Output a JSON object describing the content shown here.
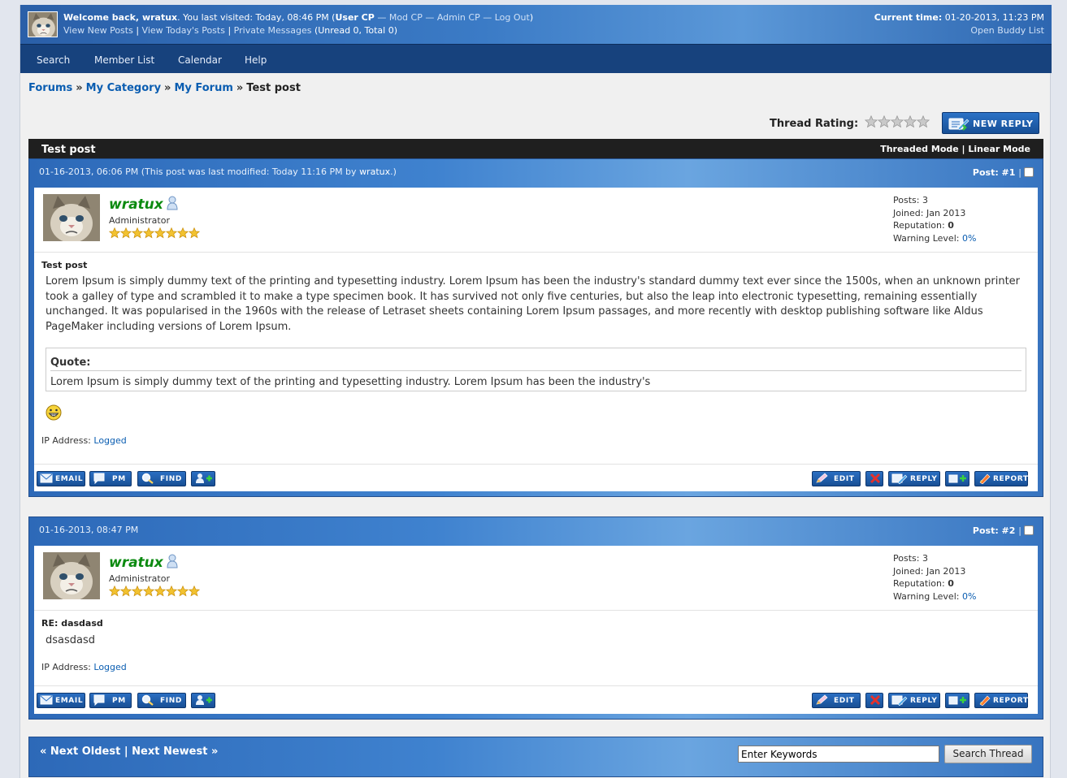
{
  "panel": {
    "welcome_prefix": "Welcome back, ",
    "username": "wratux",
    "last_visit": ". You last visited: Today, 08:46 PM (",
    "user_cp": "User CP",
    "sep": " — ",
    "mod_cp": "Mod CP",
    "admin_cp": "Admin CP",
    "logout": "Log Out",
    "close_paren": ")",
    "view_new": "View New Posts",
    "pipe": " | ",
    "view_today": "View Today's Posts",
    "pm": "Private Messages",
    "pm_counts": " (Unread 0, Total 0)",
    "current_time_label": "Current time:",
    "current_time": " 01-20-2013, 11:23 PM",
    "open_buddy": "Open Buddy List"
  },
  "menu": [
    "Search",
    "Member List",
    "Calendar",
    "Help"
  ],
  "breadcrumb": {
    "forums": "Forums",
    "category": "My Category",
    "forum": "My Forum",
    "sep": "»",
    "current": "Test post"
  },
  "thread": {
    "rating_label": "Thread Rating:",
    "rating_stars": 0,
    "rating_max": 5,
    "new_reply": "NEW REPLY",
    "title": "Test post",
    "threaded_mode": "Threaded Mode",
    "mode_sep": " | ",
    "linear_mode": "Linear Mode"
  },
  "posts": [
    {
      "date": "01-16-2013, 06:06 PM",
      "modified": " (This post was last modified: Today 11:16 PM by ",
      "modified_user": "wratux",
      "modified_end": ".)",
      "number": "Post: #1",
      "sep": "|",
      "author": "wratux",
      "author_title": "Administrator",
      "stars": 8,
      "stats": {
        "posts_label": "Posts: ",
        "posts": "3",
        "joined_label": "Joined: ",
        "joined": "Jan 2013",
        "rep_label": "Reputation: ",
        "rep": "0",
        "warn_label": "Warning Level: ",
        "warn": "0%"
      },
      "subject": "Test post",
      "message": "Lorem Ipsum is simply dummy text of the printing and typesetting industry. Lorem Ipsum has been the industry's standard dummy text ever since the 1500s, when an unknown printer took a galley of type and scrambled it to make a type specimen book. It has survived not only five centuries, but also the leap into electronic typesetting, remaining essentially unchanged. It was popularised in the 1960s with the release of Letraset sheets containing Lorem Ipsum passages, and more recently with desktop publishing software like Aldus PageMaker including versions of Lorem Ipsum.",
      "quote_label": "Quote:",
      "quote_text": "Lorem Ipsum is simply dummy text of the printing and typesetting industry. Lorem Ipsum has been the industry's",
      "ip_label": "IP Address: ",
      "ip_value": "Logged"
    },
    {
      "date": "01-16-2013, 08:47 PM",
      "number": "Post: #2",
      "sep": "|",
      "author": "wratux",
      "author_title": "Administrator",
      "stars": 8,
      "stats": {
        "posts_label": "Posts: ",
        "posts": "3",
        "joined_label": "Joined: ",
        "joined": "Jan 2013",
        "rep_label": "Reputation: ",
        "rep": "0",
        "warn_label": "Warning Level: ",
        "warn": "0%"
      },
      "subject": "RE: dasdasd",
      "message": "dsasdasd",
      "ip_label": "IP Address: ",
      "ip_value": "Logged"
    }
  ],
  "buttons": {
    "email": "EMAIL",
    "pm": "PM",
    "find": "FIND",
    "edit": "EDIT",
    "reply": "REPLY",
    "report": "REPORT"
  },
  "bottom": {
    "next_oldest": "« Next Oldest",
    "sep": " | ",
    "next_newest": "Next Newest »",
    "search_value": "Enter Keywords",
    "search_button": "Search Thread"
  },
  "colors": {
    "accent_blue": "#2d69b8",
    "menu_blue": "#17427d",
    "link": "#0a5db1",
    "username_green": "#0b8a10"
  }
}
